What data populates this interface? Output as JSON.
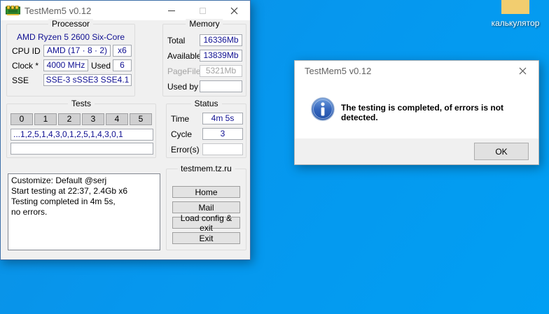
{
  "desktop": {
    "shortcut_label": "калькулятор"
  },
  "main_window": {
    "title": "TestMem5 v0.12",
    "processor": {
      "group_label": "Processor",
      "cpu_name": "AMD Ryzen 5 2600 Six-Core",
      "cpu_id_label": "CPU ID",
      "cpu_id_value": "AMD (17 · 8 · 2)",
      "cpu_count_value": "x6",
      "clock_label": "Clock *",
      "clock_value": "4000 MHz",
      "used_label": "Used",
      "used_value": "6",
      "sse_label": "SSE",
      "sse_value": "SSE-3 sSSE3 SSE4.1"
    },
    "memory": {
      "group_label": "Memory",
      "rows": [
        {
          "label": "Total",
          "value": "16336Mb"
        },
        {
          "label": "Available",
          "value": "13839Mb"
        },
        {
          "label": "PageFile",
          "value": "5321Mb"
        },
        {
          "label": "Used by test",
          "value": ""
        }
      ]
    },
    "tests": {
      "group_label": "Tests",
      "buttons": [
        "0",
        "1",
        "2",
        "3",
        "4",
        "5"
      ],
      "sequence": "...1,2,5,1,4,3,0,1,2,5,1,4,3,0,1",
      "current": ""
    },
    "status": {
      "group_label": "Status",
      "time_label": "Time",
      "time_value": "4m 5s",
      "cycle_label": "Cycle",
      "cycle_value": "3",
      "errors_label": "Error(s)",
      "errors_value": ""
    },
    "log_lines": [
      "Customize: Default @serj",
      "Start testing at 22:37, 2.4Gb x6",
      "Testing completed in 4m 5s,",
      "no errors."
    ],
    "links": {
      "group_label": "testmem.tz.ru",
      "home_label": "Home",
      "mail_label": "Mail",
      "load_label": "Load config & exit",
      "exit_label": "Exit"
    }
  },
  "dialog": {
    "title": "TestMem5 v0.12",
    "message": "The testing is completed, of errors is not detected.",
    "ok_label": "OK"
  },
  "colors": {
    "desktop_blue": "#0697ee",
    "value_navy": "#101092",
    "titlebar_white": "#ffffff"
  }
}
